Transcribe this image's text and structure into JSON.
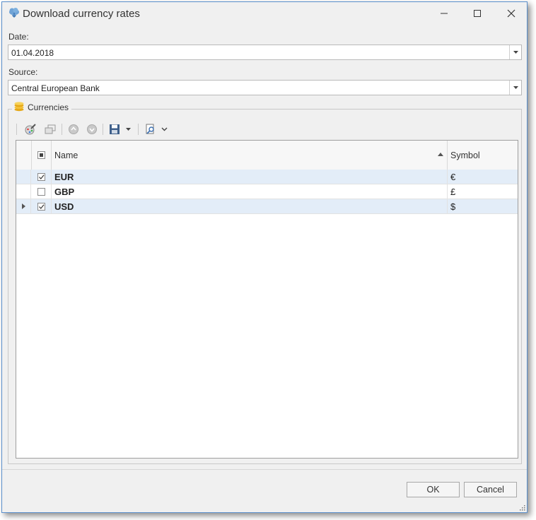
{
  "window": {
    "title": "Download currency rates"
  },
  "date": {
    "label": "Date:",
    "value": "01.04.2018"
  },
  "source": {
    "label": "Source:",
    "value": "Central European Bank"
  },
  "currencies": {
    "group_title": "Currencies",
    "columns": {
      "name": "Name",
      "symbol": "Symbol"
    },
    "rows": [
      {
        "name": "EUR",
        "symbol": "€",
        "checked": true
      },
      {
        "name": "GBP",
        "symbol": "£",
        "checked": false
      },
      {
        "name": "USD",
        "symbol": "$",
        "checked": true
      }
    ]
  },
  "buttons": {
    "ok": "OK",
    "cancel": "Cancel"
  },
  "colors": {
    "accent": "#5a8fcc",
    "selected_row": "#e3edf8"
  }
}
